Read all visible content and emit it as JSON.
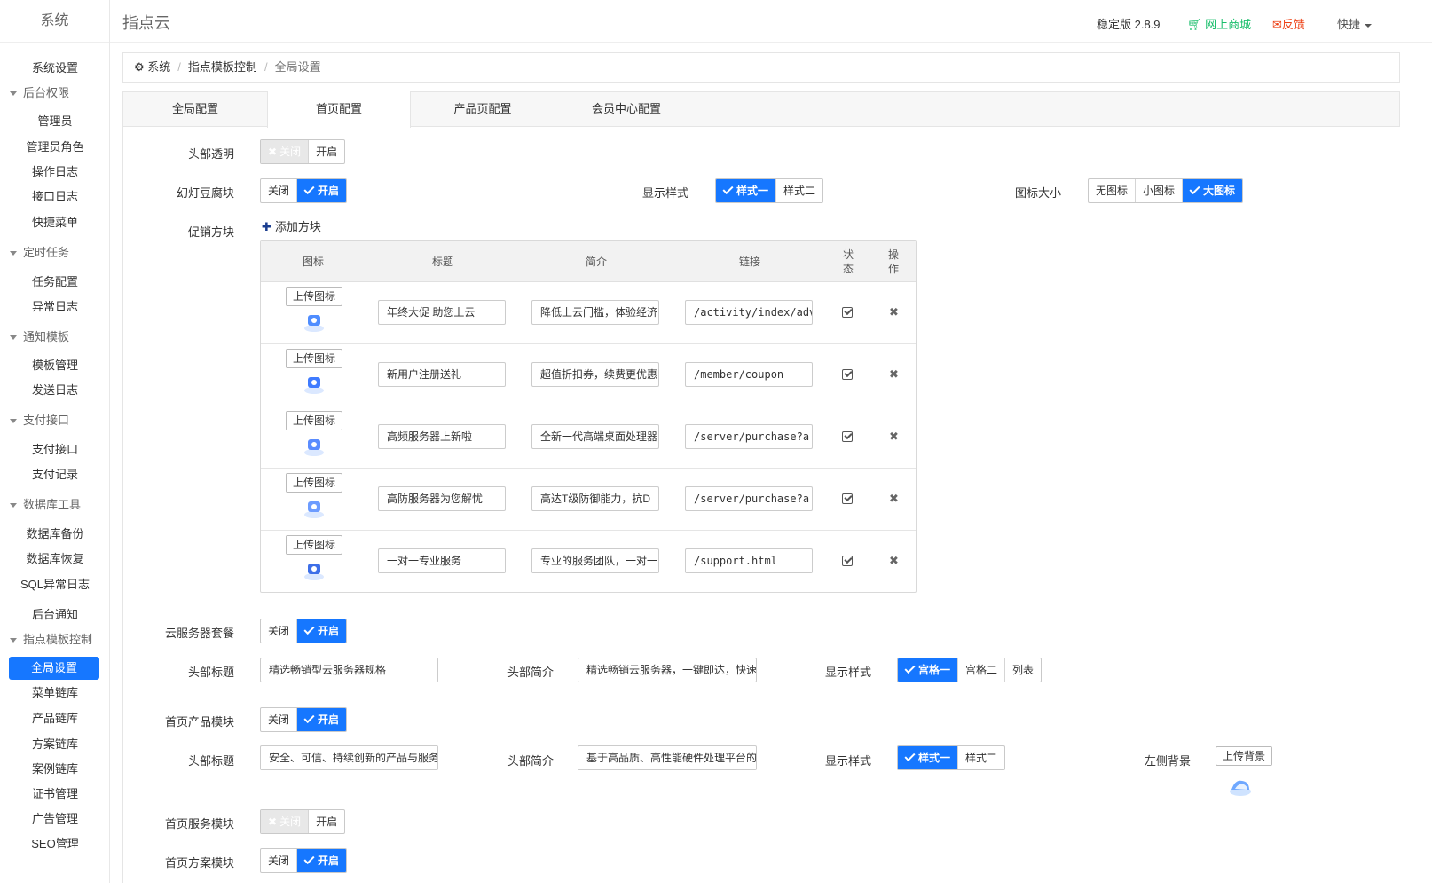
{
  "sidebar": {
    "brand": "系统",
    "items": [
      {
        "label": "系统设置",
        "type": "item"
      },
      {
        "label": "后台权限",
        "type": "group"
      },
      {
        "label": "管理员",
        "type": "item"
      },
      {
        "label": "管理员角色",
        "type": "item"
      },
      {
        "label": "操作日志",
        "type": "item"
      },
      {
        "label": "接口日志",
        "type": "item"
      },
      {
        "label": "快捷菜单",
        "type": "item"
      },
      {
        "label": "定时任务",
        "type": "group"
      },
      {
        "label": "任务配置",
        "type": "item"
      },
      {
        "label": "异常日志",
        "type": "item"
      },
      {
        "label": "通知模板",
        "type": "group"
      },
      {
        "label": "模板管理",
        "type": "item"
      },
      {
        "label": "发送日志",
        "type": "item"
      },
      {
        "label": "支付接口",
        "type": "group"
      },
      {
        "label": "支付接口",
        "type": "item"
      },
      {
        "label": "支付记录",
        "type": "item"
      },
      {
        "label": "数据库工具",
        "type": "group"
      },
      {
        "label": "数据库备份",
        "type": "item"
      },
      {
        "label": "数据库恢复",
        "type": "item"
      },
      {
        "label": "SQL异常日志",
        "type": "item"
      },
      {
        "label": "后台通知",
        "type": "item"
      },
      {
        "label": "指点模板控制",
        "type": "group"
      },
      {
        "label": "全局设置",
        "type": "item",
        "active": true
      },
      {
        "label": "菜单链库",
        "type": "item"
      },
      {
        "label": "产品链库",
        "type": "item"
      },
      {
        "label": "方案链库",
        "type": "item"
      },
      {
        "label": "案例链库",
        "type": "item"
      },
      {
        "label": "证书管理",
        "type": "item"
      },
      {
        "label": "广告管理",
        "type": "item"
      },
      {
        "label": "SEO管理",
        "type": "item"
      }
    ]
  },
  "header": {
    "title": "指点云",
    "version": "稳定版 2.8.9",
    "mall": "网上商城",
    "feedback": "反馈",
    "quick": "快捷"
  },
  "breadcrumb": {
    "root": "系统",
    "mid": "指点模板控制",
    "current": "全局设置"
  },
  "tabs": [
    "全局配置",
    "首页配置",
    "产品页配置",
    "会员中心配置"
  ],
  "common": {
    "off": "关闭",
    "on": "开启",
    "upload_icon": "上传图标",
    "add_block": "添加方块",
    "upload_bg": "上传背景"
  },
  "form": {
    "header_transparent": "头部透明",
    "slider_block": "幻灯豆腐块",
    "display_style": "显示样式",
    "style1": "样式一",
    "style2": "样式二",
    "icon_size": "图标大小",
    "no_icon": "无图标",
    "small_icon": "小图标",
    "big_icon": "大图标",
    "promo_block": "促销方块",
    "cloud_package": "云服务器套餐",
    "head_title": "头部标题",
    "head_intro": "头部简介",
    "grid1": "宫格一",
    "grid2": "宫格二",
    "list": "列表",
    "cloud_title_value": "精选畅销型云服务器规格",
    "cloud_intro_value": "精选畅销云服务器，一键即达，快速",
    "product_module": "首页产品模块",
    "product_title_value": "安全、可信、持续创新的产品与服务",
    "product_intro_value": "基于高品质、高性能硬件处理平台的",
    "left_bg": "左侧背景",
    "service_module": "首页服务模块",
    "next_module": "首页方案模块"
  },
  "promo_table": {
    "headers": [
      "图标",
      "标题",
      "简介",
      "链接",
      "状态",
      "操作"
    ],
    "rows": [
      {
        "title": "年终大促 助您上云",
        "intro": "降低上云门槛，体验经济",
        "link": "/activity/index/adv"
      },
      {
        "title": "新用户注册送礼",
        "intro": "超值折扣券，续费更优惠",
        "link": "/member/coupon"
      },
      {
        "title": "高频服务器上新啦",
        "intro": "全新一代高端桌面处理器",
        "link": "/server/purchase?a"
      },
      {
        "title": "高防服务器为您解忧",
        "intro": "高达T级防御能力，抗D",
        "link": "/server/purchase?a"
      },
      {
        "title": "一对一专业服务",
        "intro": "专业的服务团队，一对一",
        "link": "/support.html"
      }
    ]
  },
  "colors": {
    "primary": "#1677ff",
    "mall": "#19be6b",
    "feedback": "#ed4014"
  }
}
